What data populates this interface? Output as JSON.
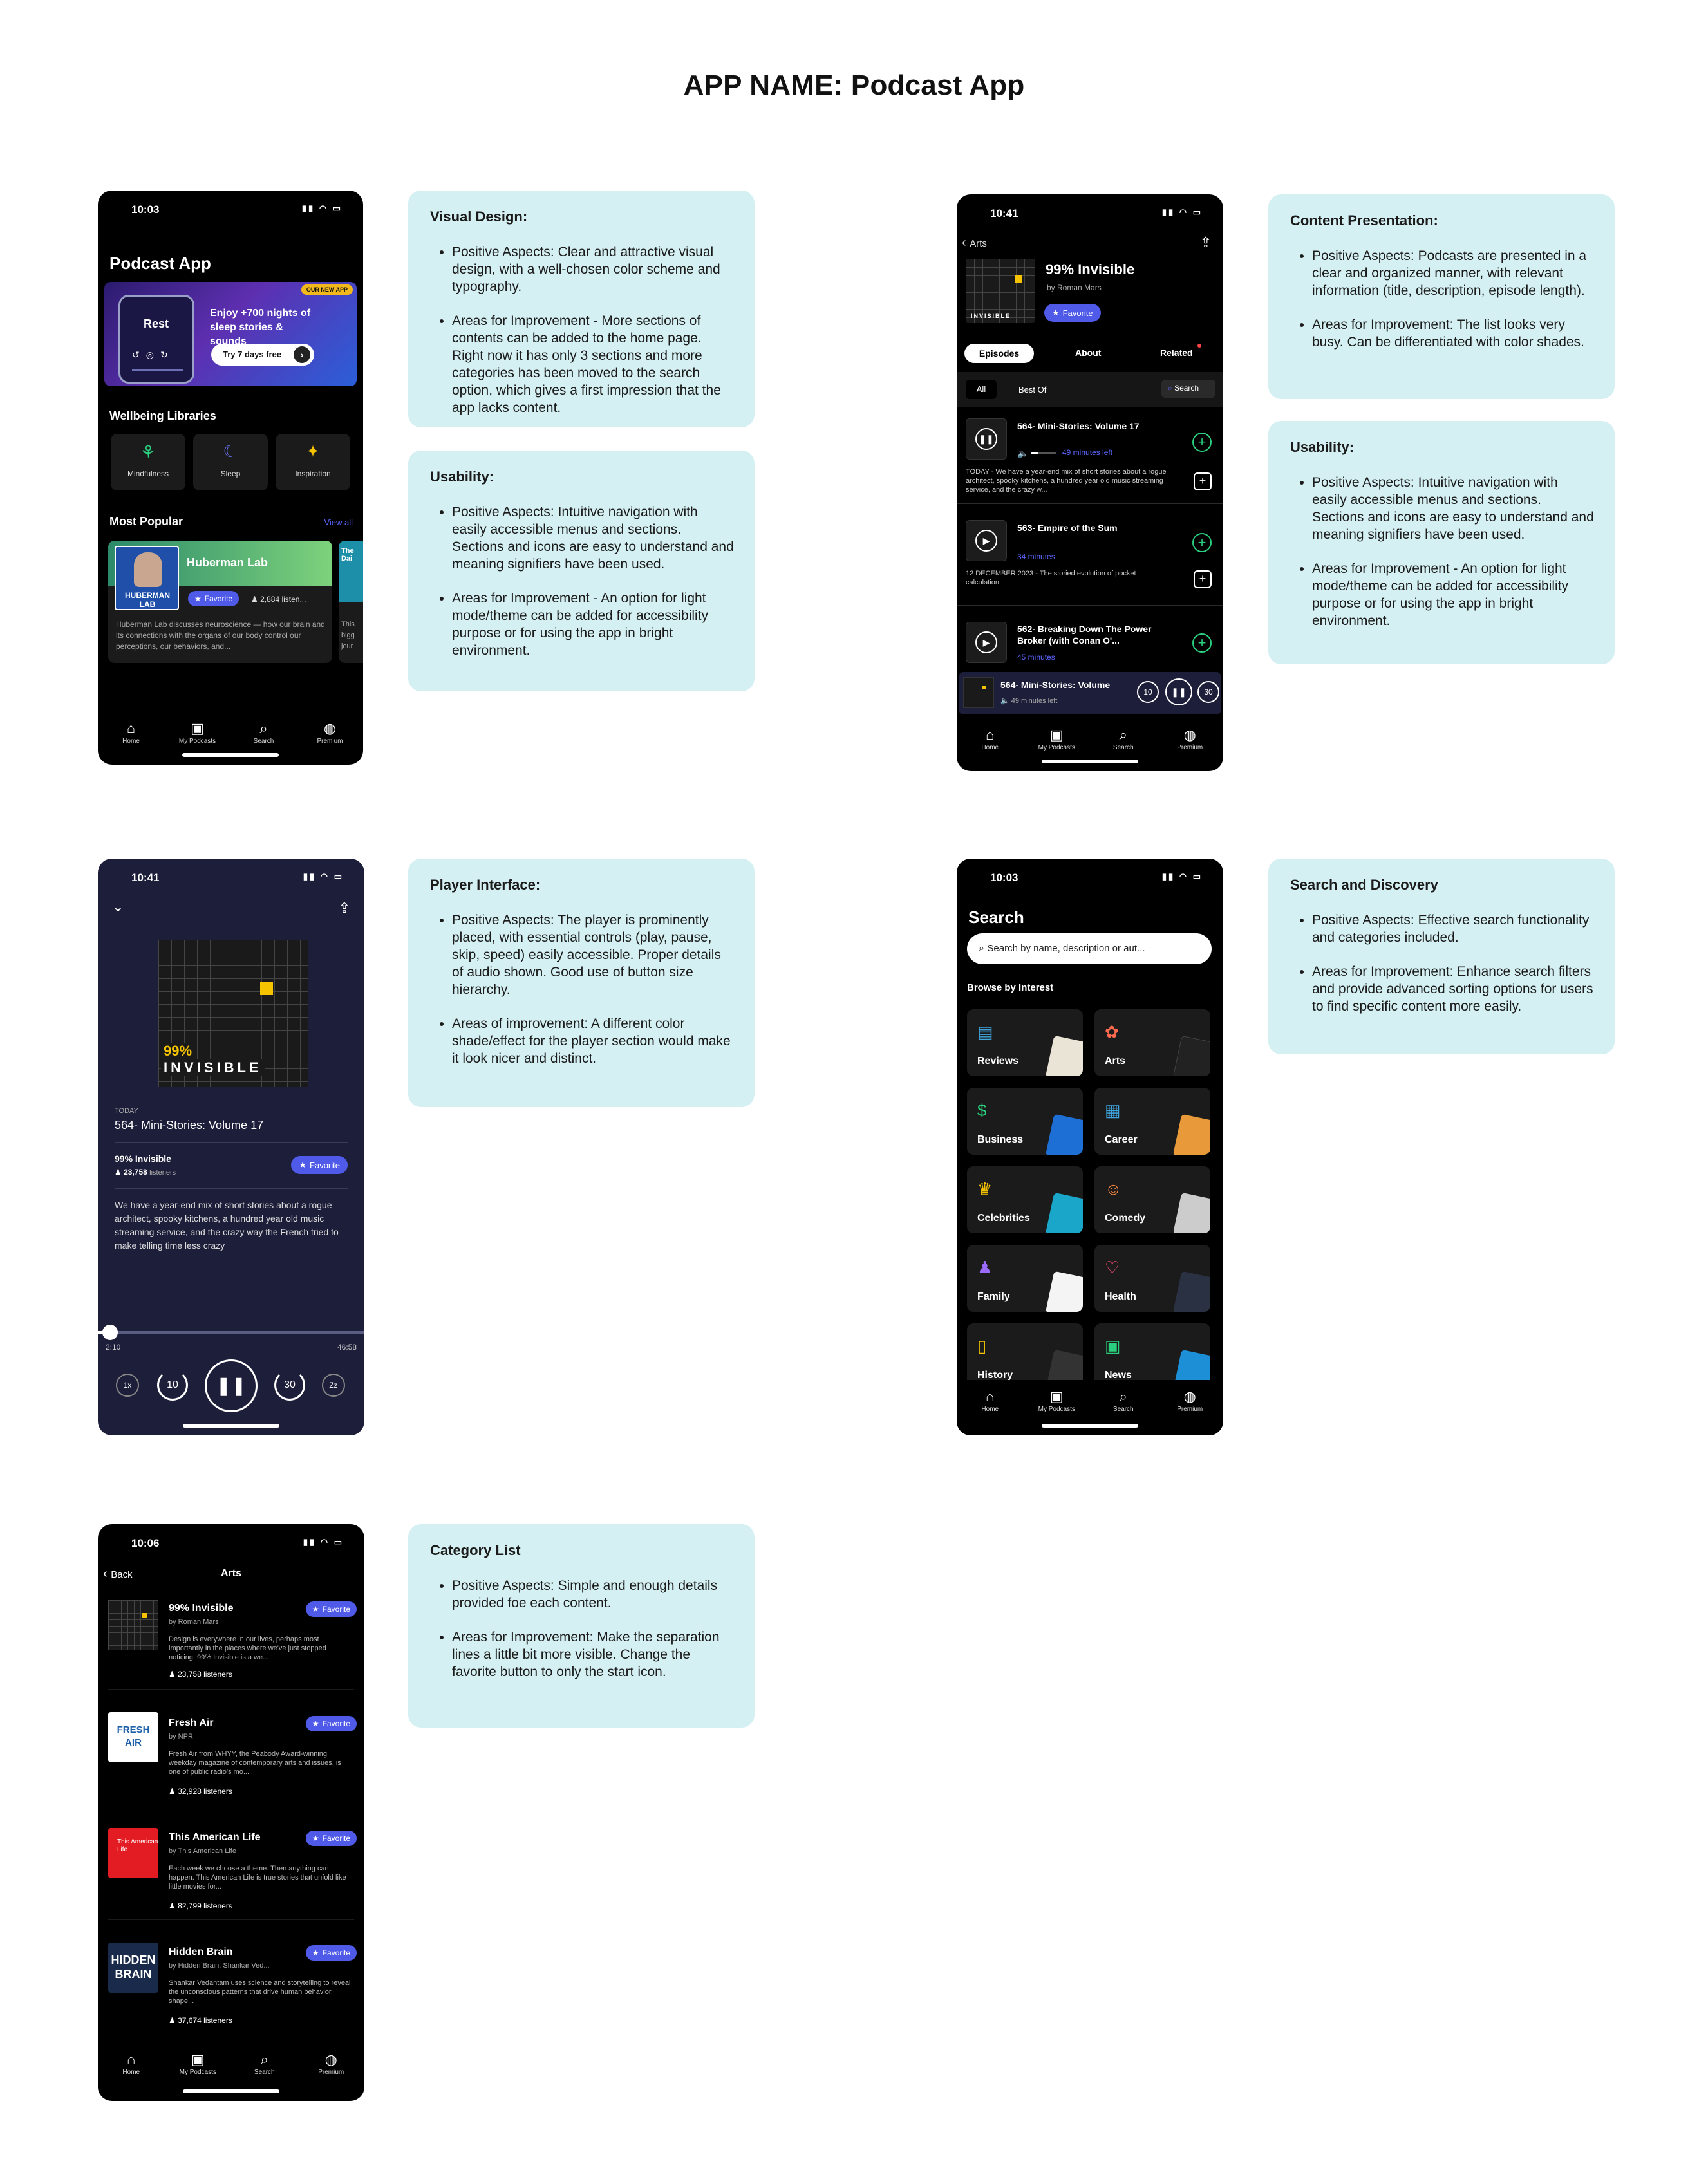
{
  "page_title": "APP NAME: Podcast App",
  "screen1": {
    "time": "10:03",
    "app_title": "Podcast App",
    "banner": {
      "badge": "OUR NEW APP",
      "rest_word": "Rest",
      "headline": "Enjoy +700 nights of sleep stories & sounds",
      "cta": "Try 7 days free"
    },
    "wellbeing_title": "Wellbeing Libraries",
    "libraries": [
      "Mindfulness",
      "Sleep",
      "Inspiration"
    ],
    "popular_title": "Most Popular",
    "view_all": "View all",
    "card": {
      "title": "Huberman Lab",
      "fav": "Favorite",
      "listeners": "2,884 listen...",
      "desc": "Huberman Lab discusses neuroscience — how our brain and its connections with the organs of our body control our perceptions, our behaviors, and...",
      "logo_text": "HUBERMAN LAB"
    },
    "card2": {
      "title_partial": "The Dai",
      "desc_partial": "This bigg jour"
    }
  },
  "tabs": [
    "Home",
    "My Podcasts",
    "Search",
    "Premium"
  ],
  "note1": {
    "title": "Visual Design:",
    "items": [
      "Positive Aspects: Clear and attractive visual design, with a well-chosen color scheme and typography.",
      "Areas for Improvement - More sections of contents can be added to the home page. Right now it has only 3 sections and more categories has been moved to the search option, which gives a first impression that the app lacks content."
    ]
  },
  "note2": {
    "title": "Usability:",
    "items": [
      "Positive Aspects: Intuitive navigation with easily accessible menus and sections. Sections and icons are easy to understand and meaning signifiers have been used.",
      "Areas for Improvement - An option for light mode/theme can be added for accessibility purpose or for using the app in bright environment."
    ]
  },
  "screen2": {
    "time": "10:41",
    "back": "Arts",
    "title": "99% Invisible",
    "author": "by Roman Mars",
    "fav": "Favorite",
    "tabs": [
      "Episodes",
      "About",
      "Related"
    ],
    "filters": [
      "All",
      "Best Of"
    ],
    "search": "Search",
    "episodes": [
      {
        "title": "564- Mini-Stories: Volume 17",
        "meta": "49 minutes left",
        "desc": "TODAY - We have a year-end mix of short stories about a rogue architect, spooky kitchens, a hundred year old music streaming service, and the crazy w..."
      },
      {
        "title": "563- Empire of the Sum",
        "meta": "34 minutes",
        "desc": "12 DECEMBER 2023 - The storied evolution of pocket calculation"
      },
      {
        "title": "562- Breaking Down The Power Broker (with Conan O'...",
        "meta": "45 minutes",
        "desc": ""
      }
    ],
    "mini_player": {
      "title": "564- Mini-Stories: Volume",
      "meta": "49 minutes left"
    }
  },
  "note3": {
    "title": "Content Presentation:",
    "items": [
      "Positive Aspects: Podcasts are presented in a clear and organized manner, with relevant information (title, description, episode length).",
      "Areas for Improvement: The list looks very busy. Can be differentiated with color shades."
    ]
  },
  "note4": {
    "title": "Usability:",
    "items": [
      "Positive Aspects: Intuitive navigation with easily accessible menus and sections. Sections and icons are easy to understand and meaning signifiers have been used.",
      "Areas for Improvement - An option for light mode/theme can be added for accessibility purpose or for using the app in bright environment."
    ]
  },
  "screen3": {
    "time": "10:41",
    "art_text1": "99%",
    "art_text2": "INVISIBLE",
    "day": "TODAY",
    "episode": "564- Mini-Stories: Volume 17",
    "show": "99% Invisible",
    "listeners": "23,758",
    "listeners_label": "listeners",
    "fav": "Favorite",
    "desc": "We have a year-end mix of short stories about a rogue architect, spooky kitchens, a hundred year old music streaming service, and the crazy way the French tried to make telling time less crazy",
    "elapsed": "2:10",
    "total": "46:58",
    "progress": 0.046,
    "speed": "1x",
    "back_sec": "10",
    "fwd_sec": "30",
    "sleep": "Zz"
  },
  "note5": {
    "title": "Player Interface:",
    "items": [
      "Positive Aspects: The player is prominently placed, with essential controls (play, pause, skip, speed) easily accessible. Proper details of audio shown. Good use of button size hierarchy.",
      "Areas of improvement: A different color shade/effect for the player section would make it look nicer and distinct."
    ]
  },
  "screen4": {
    "time": "10:03",
    "title": "Search",
    "placeholder": "Search by name, description or aut...",
    "browse": "Browse by Interest",
    "categories": [
      "Reviews",
      "Arts",
      "Business",
      "Career",
      "Celebrities",
      "Comedy",
      "Family",
      "Health",
      "History",
      "News"
    ]
  },
  "note6": {
    "title": "Search and Discovery",
    "items": [
      "Positive Aspects: Effective search functionality and categories included.",
      "Areas for Improvement: Enhance search filters and provide advanced sorting options for users to find specific content more easily."
    ]
  },
  "screen5": {
    "time": "10:06",
    "back": "Back",
    "title": "Arts",
    "items": [
      {
        "title": "99% Invisible",
        "author": "by Roman Mars",
        "desc": "Design is everywhere in our lives, perhaps most importantly in the places where we've just stopped noticing. 99% Invisible is a we...",
        "listeners": "23,758 listeners",
        "fav": "Favorite"
      },
      {
        "title": "Fresh Air",
        "author": "by NPR",
        "desc": "Fresh Air from WHYY, the Peabody Award-winning weekday magazine of contemporary arts and issues, is one of public radio's mo...",
        "listeners": "32,928 listeners",
        "fav": "Favorite"
      },
      {
        "title": "This American Life",
        "author": "by This American Life",
        "desc": "Each week we choose a theme. Then anything can happen. This American Life is true stories that unfold like little movies for...",
        "listeners": "82,799 listeners",
        "fav": "Favorite"
      },
      {
        "title": "Hidden Brain",
        "author": "by Hidden Brain, Shankar Ved...",
        "desc": "Shankar Vedantam uses science and storytelling to reveal the unconscious patterns that drive human behavior, shape...",
        "listeners": "37,674 listeners",
        "fav": "Favorite"
      }
    ],
    "logos": [
      "FRESH AIR",
      "This American Life",
      "HIDDEN BRAIN"
    ]
  },
  "note7": {
    "title": "Category List",
    "items": [
      "Positive Aspects: Simple and enough details provided foe each content.",
      "Areas for Improvement: Make the separation lines a little bit more visible. Change the favorite button to only the start icon."
    ]
  },
  "colors": {
    "accent": "#4f5ae8",
    "note_bg": "#d5f0f3",
    "player_bg": "#1d1e3a",
    "green": "#2bd07e",
    "yellow": "#f5c300"
  }
}
